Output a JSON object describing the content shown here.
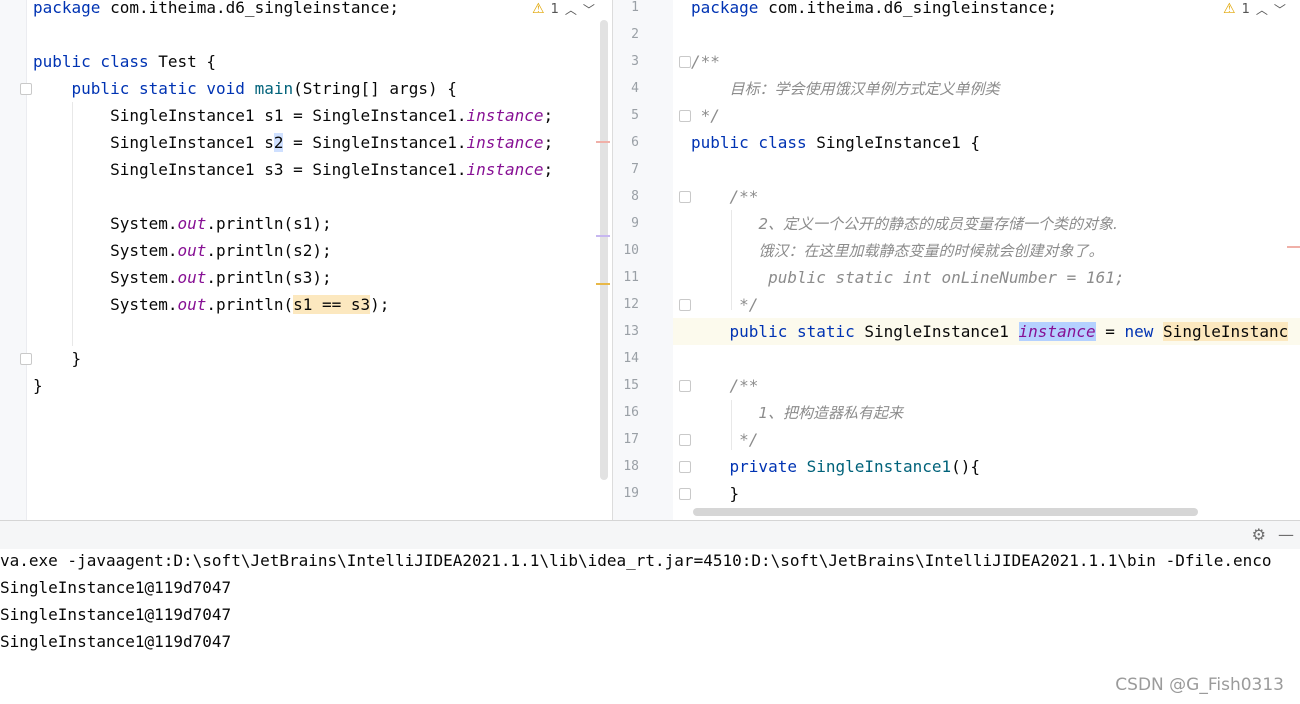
{
  "left_editor": {
    "lines": [
      "package com.itheima.d6_singleinstance;",
      "",
      "public class Test {",
      "    public static void main(String[] args) {",
      "        SingleInstance1 s1 = SingleInstance1.instance;",
      "        SingleInstance1 s2 = SingleInstance1.instance;",
      "        SingleInstance1 s3 = SingleInstance1.instance;",
      "",
      "        System.out.println(s1);",
      "        System.out.println(s2);",
      "        System.out.println(s3);",
      "        System.out.println(s1 == s3);",
      "",
      "    }",
      "}"
    ],
    "warning_count": "1"
  },
  "right_editor": {
    "line_numbers": [
      "1",
      "2",
      "3",
      "4",
      "5",
      "6",
      "7",
      "8",
      "9",
      "10",
      "11",
      "12",
      "13",
      "14",
      "15",
      "16",
      "17",
      "18",
      "19"
    ],
    "lines": [
      "package com.itheima.d6_singleinstance;",
      "",
      "/**",
      "    目标：学会使用饿汉单例方式定义单例类",
      " */",
      "public class SingleInstance1 {",
      "",
      "    /**",
      "       2、定义一个公开的静态的成员变量存储一个类的对象.",
      "       饿汉：在这里加载静态变量的时候就会创建对象了。",
      "        public static int onLineNumber = 161;",
      "     */",
      "    public static SingleInstance1 instance = new SingleInstanc",
      "",
      "    /**",
      "       1、把构造器私有起来",
      "     */",
      "    private SingleInstance1(){",
      "    }"
    ],
    "warning_count": "1"
  },
  "console": {
    "command": "va.exe -javaagent:D:\\soft\\JetBrains\\IntelliJIDEA2021.1.1\\lib\\idea_rt.jar=4510:D:\\soft\\JetBrains\\IntelliJIDEA2021.1.1\\bin -Dfile.enco",
    "output": [
      "SingleInstance1@119d7047",
      "SingleInstance1@119d7047",
      "SingleInstance1@119d7047"
    ]
  },
  "watermark": "CSDN @G_Fish0313",
  "icons": {
    "warning": "warning-triangle-icon",
    "up": "chevron-up-icon",
    "down": "chevron-down-icon",
    "settings": "gear-icon",
    "minimize": "minimize-icon"
  },
  "colors": {
    "keyword": "#0033b3",
    "static_field": "#871094",
    "comment": "#8c8c8c",
    "selection": "#b5d1ff",
    "match_highlight": "#fce8bf"
  }
}
